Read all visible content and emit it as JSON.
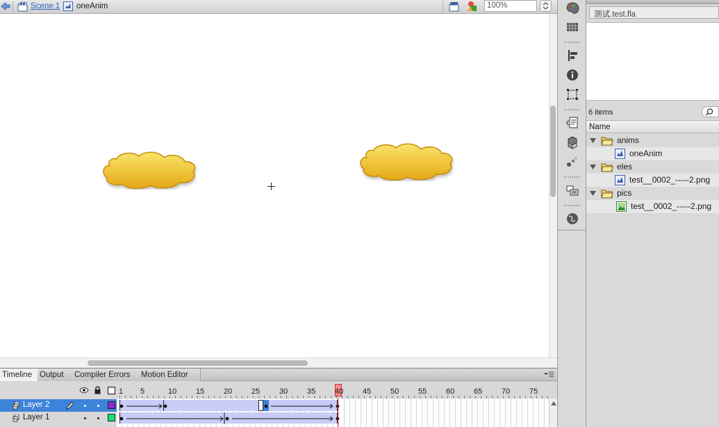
{
  "editbar": {
    "scene_label": "Scene 1",
    "symbol_label": "oneAnim",
    "zoom_value": "100%"
  },
  "stage": {
    "objects": [
      {
        "name": "cloud",
        "color": "#f0c419"
      },
      {
        "name": "cloud",
        "color": "#f0c419"
      }
    ]
  },
  "tools": [
    "palette-icon",
    "swatches-icon",
    "align-icon",
    "info-icon",
    "transform-icon",
    "code-snippets-icon",
    "components-icon",
    "motion-presets-icon",
    "project-icon",
    "web-icon"
  ],
  "library": {
    "document": "测试.test.fla",
    "item_count": "6 items",
    "column_name": "Name",
    "items": [
      {
        "label": "anims",
        "type": "folder"
      },
      {
        "label": "oneAnim",
        "type": "movieclip"
      },
      {
        "label": "eles",
        "type": "folder"
      },
      {
        "label": "test__0002_-----2.png",
        "type": "movieclip"
      },
      {
        "label": "pics",
        "type": "folder"
      },
      {
        "label": "test__0002_-----2.png",
        "type": "bitmap"
      }
    ]
  },
  "timeline": {
    "tabs": [
      "Timeline",
      "Output",
      "Compiler Errors",
      "Motion Editor"
    ],
    "frame_numbers": [
      "1",
      "5",
      "10",
      "15",
      "20",
      "25",
      "30",
      "35",
      "40",
      "45",
      "50",
      "55",
      "60",
      "65",
      "70",
      "75"
    ],
    "current_frame": "40",
    "layers": [
      {
        "name": "Layer 2",
        "color": "#8e2bd3",
        "selected": true
      },
      {
        "name": "Layer 1",
        "color": "#19e07a",
        "selected": false
      }
    ]
  },
  "colors": {
    "selection": "#3d83d9",
    "tween": "#c9ccf6",
    "playhead": "#ff5a5a"
  }
}
